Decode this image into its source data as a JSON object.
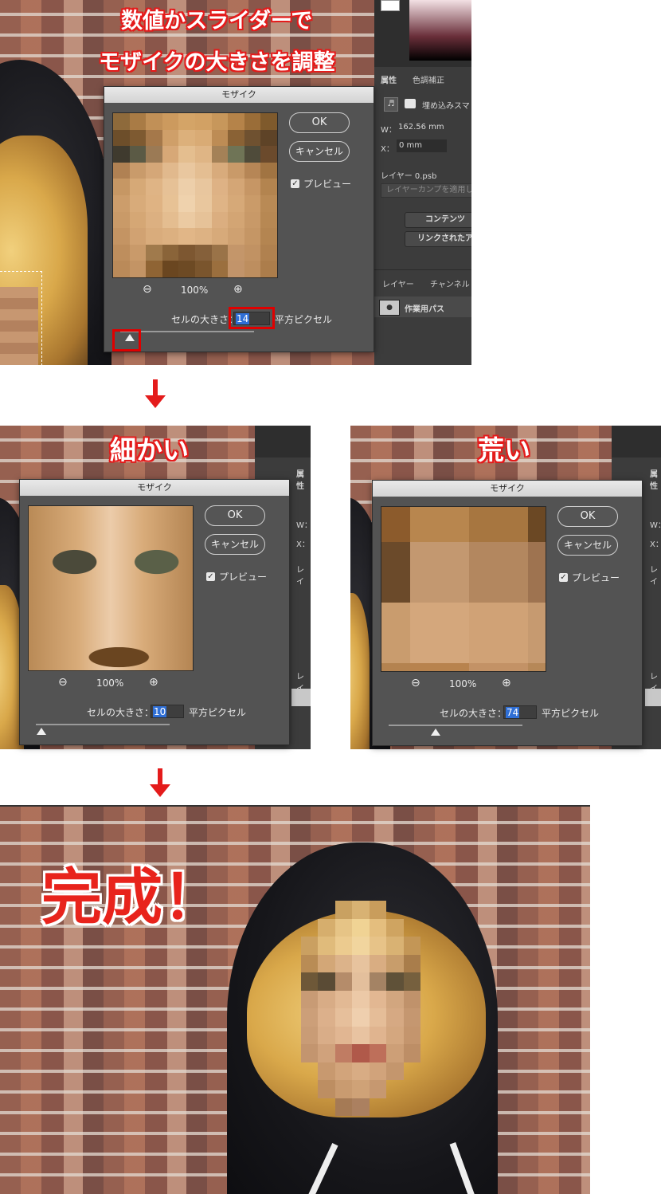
{
  "headline_top_line1": "数値かスライダーで",
  "headline_top_line2": "モザイクの大きさを調整",
  "label_fine": "細かい",
  "label_coarse": "荒い",
  "label_done": "完成！",
  "dialog": {
    "title": "モザイク",
    "ok_label": "OK",
    "cancel_label": "キャンセル",
    "preview_label": "プレビュー",
    "zoom_level": "100%",
    "cell_size_label": "セルの大きさ：",
    "cell_unit": "平方ピクセル"
  },
  "dialogs": [
    {
      "cell_size": "14",
      "slider_fraction": 0.07
    },
    {
      "cell_size": "10",
      "slider_fraction": 0.04
    },
    {
      "cell_size": "74",
      "slider_fraction": 0.35
    }
  ],
  "ps_panel": {
    "tab_properties": "属性",
    "tab_adjustments": "色調補正",
    "smart_object_label": "埋め込みスマ",
    "width_label": "W：",
    "width_value": "162.56 mm",
    "x_label": "X：",
    "x_value": "0 mm",
    "layer_name": "レイヤー 0.psb",
    "layer_comp_placeholder": "レイヤーカンプを適用し",
    "content_button": "コンテンツ",
    "linked_button": "リンクされたア",
    "tab_layers": "レイヤー",
    "tab_channels": "チャンネル",
    "work_path": "作業用パス",
    "tab_props_short": "属性",
    "w_short": "W：",
    "x_short": "X：",
    "layer_short": "レイ",
    "layers_short": "レイ"
  },
  "colors": {
    "accent_red": "#e8231c",
    "dialog_bg": "#535353",
    "panel_bg": "#3c3c3c",
    "selection_blue": "#2f6fd6"
  }
}
